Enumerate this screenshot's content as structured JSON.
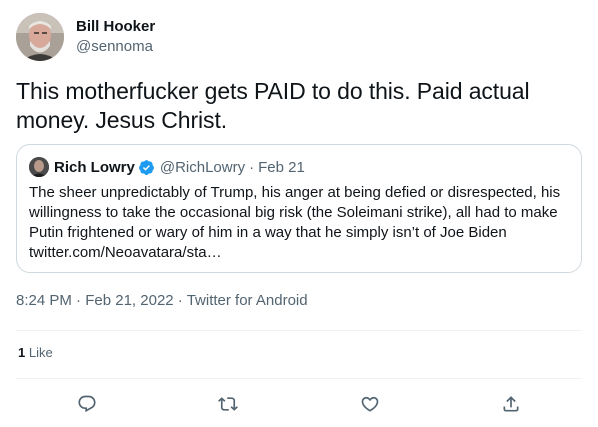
{
  "author": {
    "display_name": "Bill Hooker",
    "handle": "@sennoma"
  },
  "tweet": {
    "text": "This motherfucker gets PAID to do this. Paid actual money. Jesus Christ."
  },
  "quoted_tweet": {
    "display_name": "Rich Lowry",
    "handle": "@RichLowry",
    "separator": "·",
    "date": "Feb 21",
    "text": "The sheer unpredictably of Trump, his anger at being defied or disrespected, his willingness to take the occasional big risk (the Soleimani strike), all had to make Putin frightened or wary of him in a way that he simply isn’t of Joe Biden twitter.com/Neoavatara/sta…"
  },
  "meta": {
    "time": "8:24 PM",
    "sep1": "·",
    "date": "Feb 21, 2022",
    "sep2": "·",
    "source": "Twitter for Android"
  },
  "stats": {
    "like_count": "1",
    "like_label": "Like"
  },
  "actions": {
    "icons": [
      "reply-icon",
      "retweet-icon",
      "like-icon",
      "share-icon"
    ]
  },
  "colors": {
    "text": "#0f1419",
    "secondary": "#536471",
    "border": "#cfd9de",
    "verified": "#1d9bf0"
  }
}
